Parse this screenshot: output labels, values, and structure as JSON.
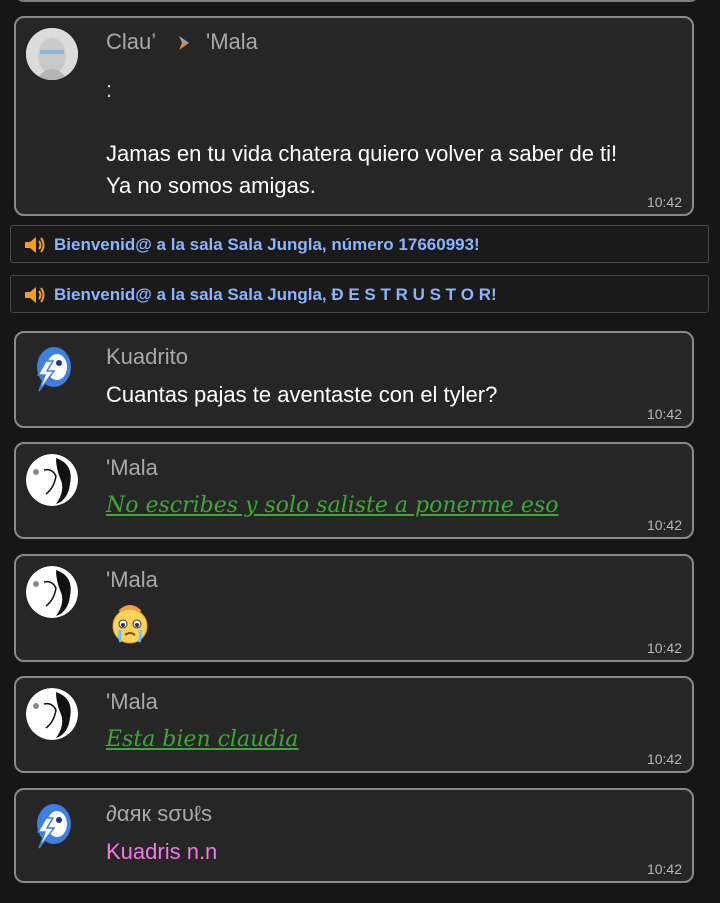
{
  "messages": [
    {
      "sender": "Clau’",
      "recipient": "'Mala",
      "text_line0": ":",
      "text_line1": "Jamas en tu vida chatera quiero volver a saber de ti!",
      "text_line2": "Ya no somos amigas.",
      "time": "10:42"
    },
    {
      "sender": "Kuadrito",
      "text": "Cuantas pajas te aventaste con el tyler?",
      "time": "10:42"
    },
    {
      "sender": "'Mala",
      "text": "No escribes y solo saliste a ponerme eso",
      "time": "10:42",
      "style": "green"
    },
    {
      "sender": "'Mala",
      "emoji": "crying-face-emoji",
      "time": "10:42"
    },
    {
      "sender": "'Mala",
      "text": "Esta bien claudia",
      "time": "10:42",
      "style": "green"
    },
    {
      "sender": "∂αяк ѕσυℓѕ",
      "text": "Kuadris n.n",
      "time": "10:42",
      "style": "pink"
    }
  ],
  "system": [
    {
      "icon": "speaker-icon",
      "text": "Bienvenid@ a la sala Sala Jungla, número 17660993!"
    },
    {
      "icon": "speaker-icon",
      "text": "Bienvenid@ a la sala Sala Jungla, Đ E S T R U S T O R!"
    }
  ],
  "colors": {
    "bubble_bg": "#262626",
    "bubble_border": "#8a8a8a",
    "system_text": "#8bb4ff",
    "green_text": "#3fa63a",
    "pink_text": "#f07be0"
  }
}
